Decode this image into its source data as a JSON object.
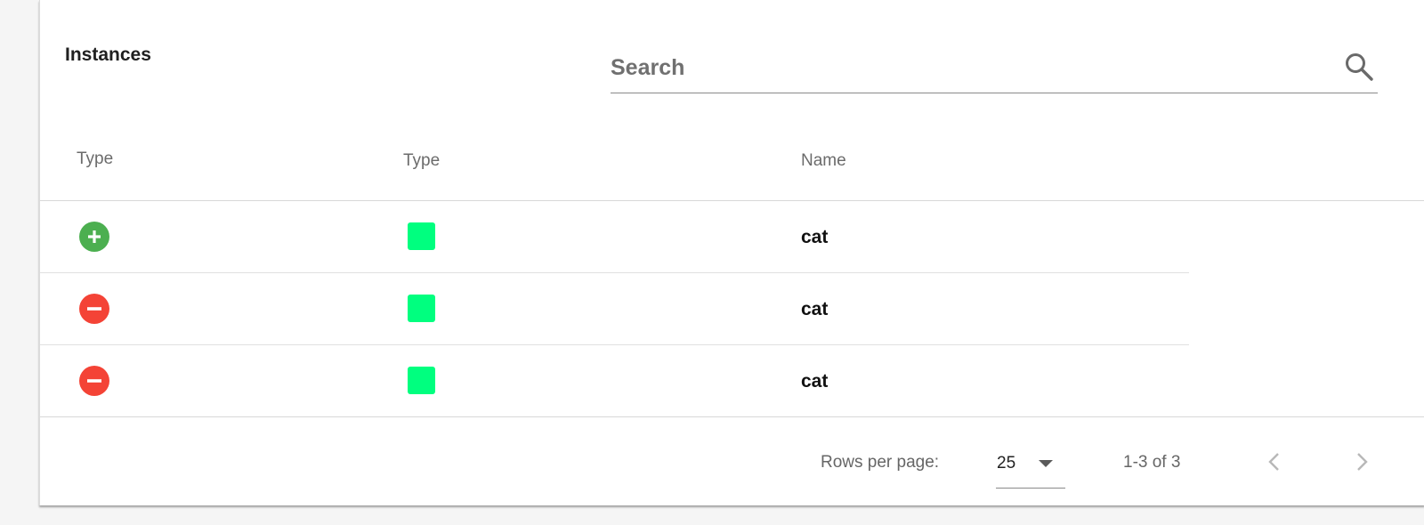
{
  "header": {
    "title": "Instances"
  },
  "search": {
    "placeholder": "Search",
    "value": "",
    "icon": "search-icon"
  },
  "table": {
    "columns": [
      "Type",
      "Type",
      "Name"
    ],
    "rows": [
      {
        "status": "add",
        "status_color": "#4caf50",
        "swatch_color": "#00ff7f",
        "name": "cat"
      },
      {
        "status": "remove",
        "status_color": "#f44336",
        "swatch_color": "#00ff7f",
        "name": "cat"
      },
      {
        "status": "remove",
        "status_color": "#f44336",
        "swatch_color": "#00ff7f",
        "name": "cat"
      }
    ]
  },
  "pagination": {
    "rows_per_page_label": "Rows per page:",
    "rows_per_page": "25",
    "range_text": "1-3 of 3",
    "prev_icon": "chevron-left-icon",
    "next_icon": "chevron-right-icon"
  }
}
